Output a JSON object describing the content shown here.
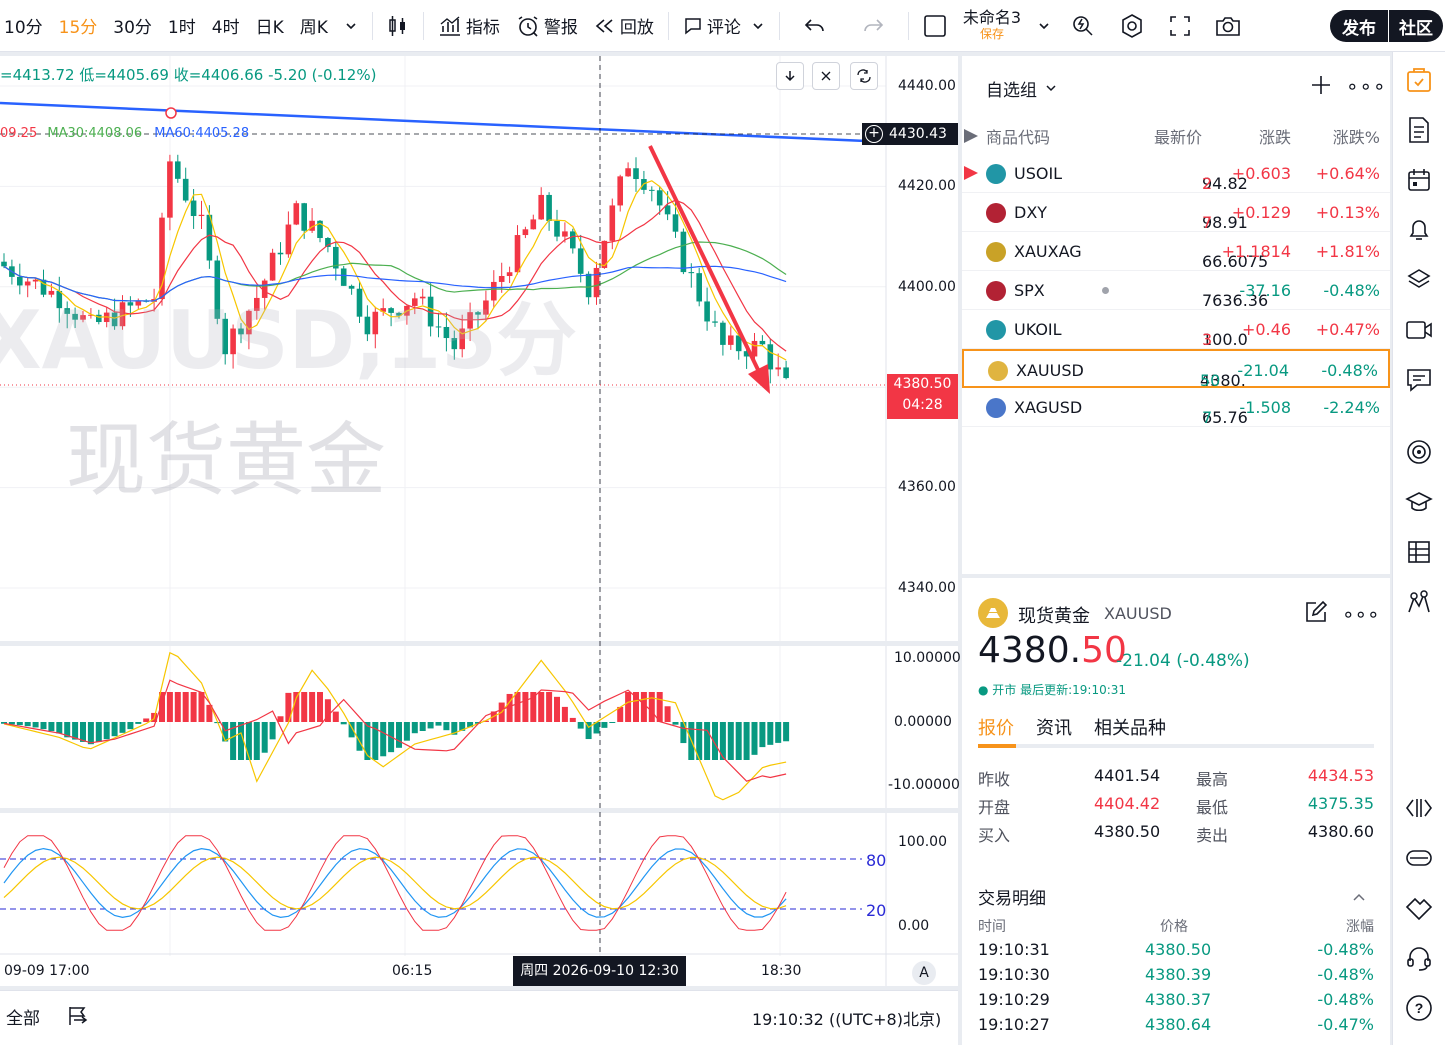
{
  "toolbar": {
    "intervals": [
      "10分",
      "15分",
      "30分",
      "1时",
      "4时",
      "日K",
      "周K"
    ],
    "active_interval": "15分",
    "indicators_label": "指标",
    "alert_label": "警报",
    "replay_label": "回放",
    "comment_label": "评论",
    "layout_name": "未命名3",
    "layout_save": "保存",
    "publish_label": "发布",
    "community_label": "社区"
  },
  "chart": {
    "ohlc_text": "=4413.72 低=4405.69 收=4406.66 -5.20 (-0.12%)",
    "ma_text": {
      "ma_a": "09.25",
      "ma30": "MA30:4408.06",
      "ma60": "MA60:4405.28"
    },
    "watermark_symbol": "XAUUSD,15分",
    "watermark_name": "现货黄金",
    "price_ticks": [
      "4440.00",
      "4420.00",
      "4400.00",
      "4380.00",
      "4360.00",
      "4340.00"
    ],
    "crosshair_price": "4430.43",
    "last_price": "4380.50",
    "countdown": "04:28",
    "macd_ticks": [
      "10.00000",
      "0.00000",
      "-10.00000"
    ],
    "kdj_ticks": [
      "100.00",
      "80",
      "20",
      "0.00"
    ],
    "time_labels": [
      "09-09 17:00",
      "06:15",
      "18:30"
    ],
    "crosshair_time": "周四 2026-09-10  12:30",
    "auto_label": "A"
  },
  "bottom": {
    "all_label": "全部",
    "clock": "19:10:32 ((UTC+8)北京)"
  },
  "watchlist": {
    "title": "自选组",
    "columns": [
      "商品代码",
      "最新价",
      "涨跌",
      "涨跌%"
    ],
    "rows": [
      {
        "symbol": "USOIL",
        "price_main": "94.82",
        "price_tail": "2",
        "change": "+0.603",
        "pct": "+0.64%",
        "dir": "up",
        "icon_color": "#2196a6"
      },
      {
        "symbol": "DXY",
        "price_main": "98.91",
        "price_tail": "7",
        "change": "+0.129",
        "pct": "+0.13%",
        "dir": "up",
        "icon_color": "#b22234"
      },
      {
        "symbol": "XAUXAG",
        "price_main": "66.6075",
        "price_tail": "",
        "change": "+1.1814",
        "pct": "+1.81%",
        "dir": "up",
        "icon_color": "#c9a227"
      },
      {
        "symbol": "SPX",
        "price_main": "7636.36",
        "price_tail": "",
        "change": "-37.16",
        "pct": "-0.48%",
        "dir": "down",
        "icon_color": "#b22234"
      },
      {
        "symbol": "UKOIL",
        "price_main": "100.0",
        "price_tail": "3",
        "change": "+0.46",
        "pct": "+0.47%",
        "dir": "up",
        "icon_color": "#2196a6"
      },
      {
        "symbol": "XAUUSD",
        "price_main": "4380.",
        "price_tail": "50",
        "change": "-21.04",
        "pct": "-0.48%",
        "dir": "down",
        "icon_color": "#e0b440"
      },
      {
        "symbol": "XAGUSD",
        "price_main": "65.76",
        "price_tail": "7",
        "change": "-1.508",
        "pct": "-2.24%",
        "dir": "down",
        "icon_color": "#4a76c9"
      }
    ]
  },
  "detail": {
    "name": "现货黄金",
    "symbol": "XAUUSD",
    "price_main": "4380.",
    "price_tail": "50",
    "change": "-21.04 (-0.48%)",
    "status": "● 开市 最后更新:19:10:31",
    "tabs": [
      "报价",
      "资讯",
      "相关品种"
    ],
    "stats": [
      {
        "label": "昨收",
        "value": "4401.54",
        "label2": "最高",
        "value2": "4434.53"
      },
      {
        "label": "开盘",
        "value": "4404.42",
        "label2": "最低",
        "value2": "4375.35"
      },
      {
        "label": "买入",
        "value": "4380.50",
        "label2": "卖出",
        "value2": "4380.60"
      }
    ],
    "trades_title": "交易明细",
    "trades_cols": [
      "时间",
      "价格",
      "涨幅"
    ],
    "trades": [
      {
        "time": "19:10:31",
        "price": "4380.50",
        "pct": "-0.48%"
      },
      {
        "time": "19:10:30",
        "price": "4380.39",
        "pct": "-0.48%"
      },
      {
        "time": "19:10:29",
        "price": "4380.37",
        "pct": "-0.48%"
      },
      {
        "time": "19:10:27",
        "price": "4380.64",
        "pct": "-0.47%"
      }
    ]
  },
  "colors": {
    "up": "#f23645",
    "down": "#089981",
    "accent": "#f7931a",
    "trendline": "#2962ff"
  }
}
